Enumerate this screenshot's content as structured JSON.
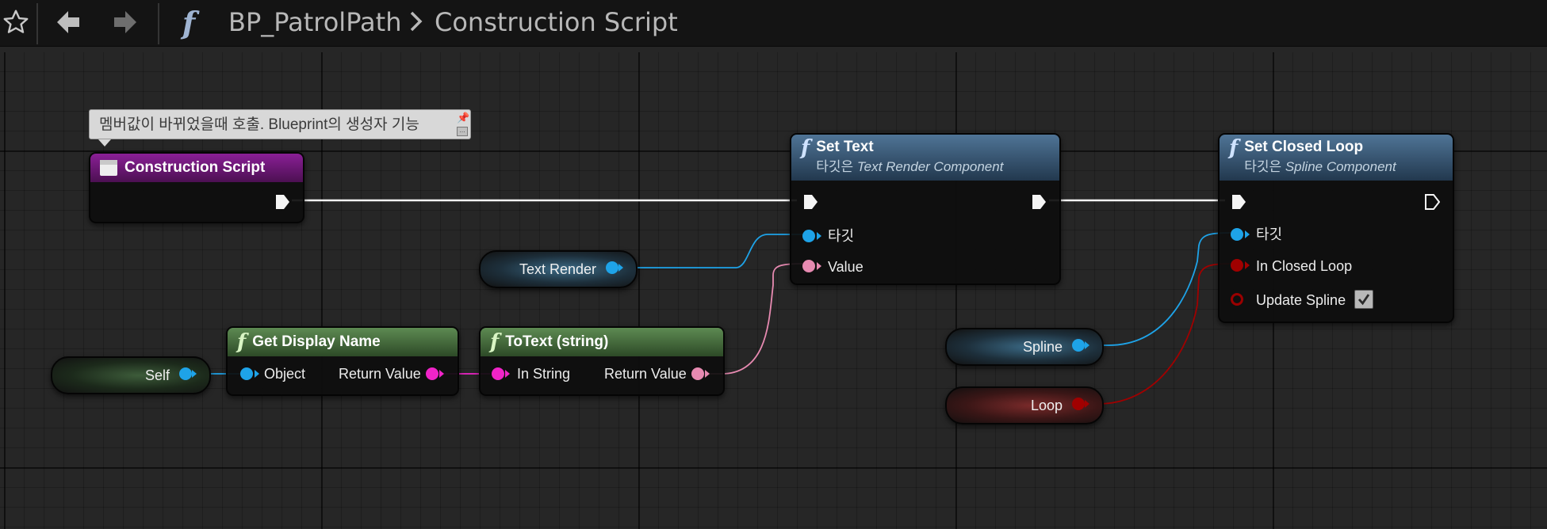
{
  "toolbar": {
    "favorite_icon": "star-outline-icon",
    "back_icon": "arrow-left-icon",
    "forward_icon": "arrow-right-icon",
    "function_icon": "function-f-icon",
    "breadcrumb_root": "BP_PatrolPath",
    "breadcrumb_separator_icon": "chevron-right-icon",
    "breadcrumb_current": "Construction Script"
  },
  "comment": {
    "text": "멤버값이 바뀌었을때 호출. Blueprint의 생성자 기능",
    "pin_icon": "pushpin-icon"
  },
  "nodes": {
    "construction_script": {
      "title": "Construction Script",
      "icon": "script-event-icon"
    },
    "set_text": {
      "title": "Set Text",
      "subtitle_prefix": "타깃은 ",
      "subtitle_target": "Text Render Component",
      "pin_target": "타깃",
      "pin_value": "Value"
    },
    "set_closed_loop": {
      "title": "Set Closed Loop",
      "subtitle_prefix": "타깃은 ",
      "subtitle_target": "Spline Component",
      "pin_target": "타깃",
      "pin_in_closed_loop": "In Closed Loop",
      "pin_update_spline": "Update Spline",
      "update_spline_checked": true
    },
    "get_display_name": {
      "title": "Get Display Name",
      "pin_object": "Object",
      "pin_return": "Return Value"
    },
    "to_text": {
      "title": "ToText (string)",
      "pin_in": "In String",
      "pin_return": "Return Value"
    }
  },
  "variables": {
    "text_render": "Text Render",
    "self": "Self",
    "spline": "Spline",
    "loop": "Loop"
  },
  "colors": {
    "exec": "#ffffff",
    "object_pin": "#1ea3e8",
    "string_pin": "#f024c8",
    "text_pin": "#e78ab1",
    "bool_pin": "#a00000",
    "event_header": "#8a1f96",
    "pure_header": "#5d8a52",
    "function_header": "#4f7496"
  }
}
